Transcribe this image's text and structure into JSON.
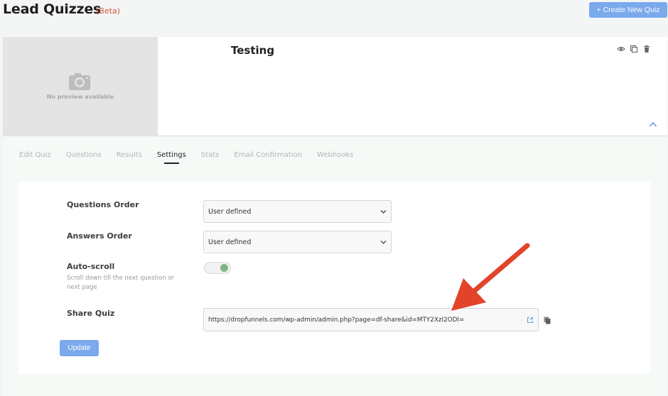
{
  "header": {
    "title": "Lead Quizzes",
    "badge": "(Beta)",
    "create_label": "+ Create New Quiz"
  },
  "quiz": {
    "title": "Testing",
    "preview_text": "No preview available",
    "actions": [
      "eye-icon",
      "copy-icon",
      "trash-icon"
    ]
  },
  "tabs": [
    {
      "label": "Edit Quiz",
      "active": false
    },
    {
      "label": "Questions",
      "active": false
    },
    {
      "label": "Results",
      "active": false
    },
    {
      "label": "Settings",
      "active": true
    },
    {
      "label": "Stats",
      "active": false
    },
    {
      "label": "Email Confirmation",
      "active": false
    },
    {
      "label": "Webhooks",
      "active": false
    }
  ],
  "settings": {
    "questions_order": {
      "label": "Questions Order",
      "value": "User defined"
    },
    "answers_order": {
      "label": "Answers Order",
      "value": "User defined"
    },
    "auto_scroll": {
      "label": "Auto-scroll",
      "help": "Scroll down till the next question or next page",
      "enabled": true
    },
    "share": {
      "label": "Share Quiz",
      "url": "https://dropfunnels.com/wp-admin/admin.php?page=df-share&id=MTY2XzI2ODI="
    },
    "update_label": "Update"
  },
  "colors": {
    "accent": "#7aa9ec",
    "badge": "#c8553a",
    "toggle_on": "#7fb584",
    "arrow": "#e2442a"
  }
}
